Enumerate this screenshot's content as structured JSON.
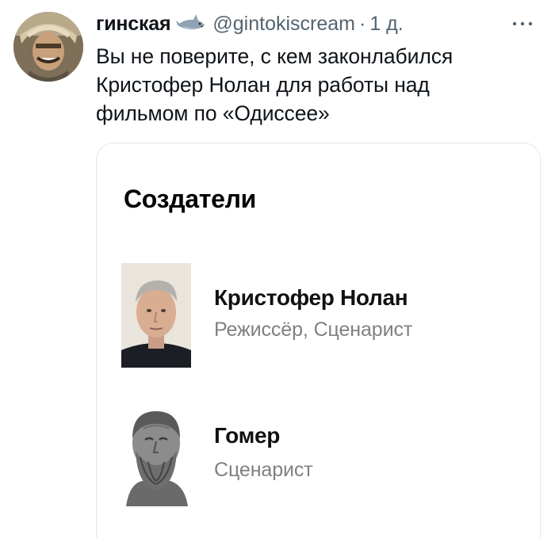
{
  "tweet": {
    "author_name": "гинская",
    "name_emoji": "shark-emoji",
    "handle": "@gintokiscream",
    "separator": "·",
    "time": "1 д.",
    "text": "Вы не поверите, с кем законлабился\nКристофер Нолан для работы над\nфильмом по «Одиссее»",
    "more_icon": "more-horizontal-icon"
  },
  "card": {
    "title": "Создатели",
    "people": [
      {
        "name": "Кристофер Нолан",
        "role": "Режиссёр, Сценарист",
        "photo": "person-photo"
      },
      {
        "name": "Гомер",
        "role": "Сценарист",
        "photo": "bust-photo"
      }
    ]
  }
}
